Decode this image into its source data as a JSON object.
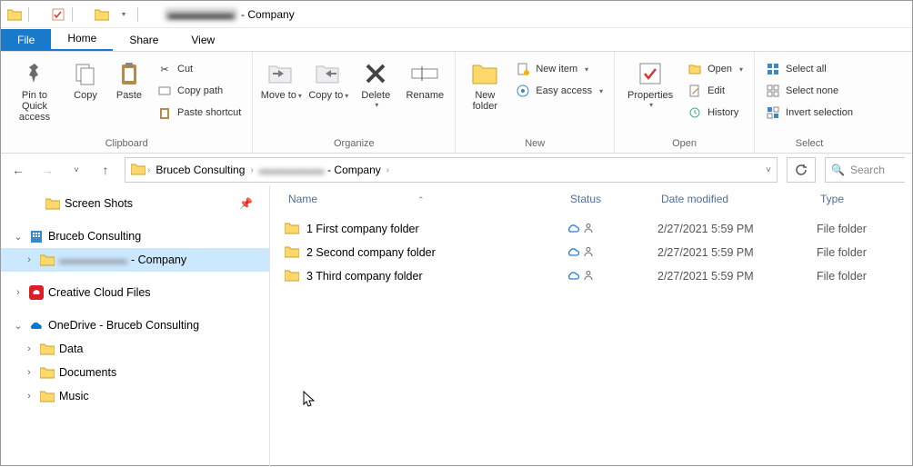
{
  "title": {
    "redacted": "▬▬▬▬▬▬",
    "suffix": " - Company"
  },
  "tabs": {
    "file": "File",
    "home": "Home",
    "share": "Share",
    "view": "View"
  },
  "ribbon": {
    "clipboard": {
      "label": "Clipboard",
      "pin": "Pin to Quick access",
      "copy": "Copy",
      "paste": "Paste",
      "cut": "Cut",
      "copypath": "Copy path",
      "pasteshortcut": "Paste shortcut"
    },
    "organize": {
      "label": "Organize",
      "moveto": "Move to",
      "copyto": "Copy to",
      "delete": "Delete",
      "rename": "Rename"
    },
    "new_": {
      "label": "New",
      "newfolder": "New folder",
      "newitem": "New item",
      "easyaccess": "Easy access"
    },
    "open": {
      "label": "Open",
      "properties": "Properties",
      "open": "Open",
      "edit": "Edit",
      "history": "History"
    },
    "select": {
      "label": "Select",
      "all": "Select all",
      "none": "Select none",
      "invert": "Invert selection"
    }
  },
  "breadcrumbs": {
    "root": "Bruceb Consulting",
    "redacted": "▬▬▬▬▬▬",
    "suffix": " - Company"
  },
  "search_placeholder": "Search",
  "sidebar": {
    "items": [
      {
        "label": "Screen Shots",
        "kind": "folder",
        "indent": 1,
        "pin": true
      },
      {
        "label": "Bruceb Consulting",
        "kind": "building",
        "indent": 0,
        "expanded": true
      },
      {
        "label_prefix": "▬▬▬▬▬▬",
        "label": " - Company",
        "kind": "folder",
        "indent": 1,
        "selected": true,
        "caret": true
      },
      {
        "label": "Creative Cloud Files",
        "kind": "cc",
        "indent": 0,
        "caret": true
      },
      {
        "label": "OneDrive - Bruceb Consulting",
        "kind": "onedrive",
        "indent": 0,
        "expanded": true
      },
      {
        "label": "Data",
        "kind": "folder",
        "indent": 1,
        "caret": true
      },
      {
        "label": "Documents",
        "kind": "folder",
        "indent": 1,
        "caret": true
      },
      {
        "label": "Music",
        "kind": "folder",
        "indent": 1,
        "caret": true
      }
    ]
  },
  "columns": {
    "name": "Name",
    "status": "Status",
    "date": "Date modified",
    "type": "Type"
  },
  "rows": [
    {
      "name": "1 First company folder",
      "date": "2/27/2021 5:59 PM",
      "type": "File folder"
    },
    {
      "name": "2 Second company folder",
      "date": "2/27/2021 5:59 PM",
      "type": "File folder"
    },
    {
      "name": "3 Third company folder",
      "date": "2/27/2021 5:59 PM",
      "type": "File folder"
    }
  ]
}
